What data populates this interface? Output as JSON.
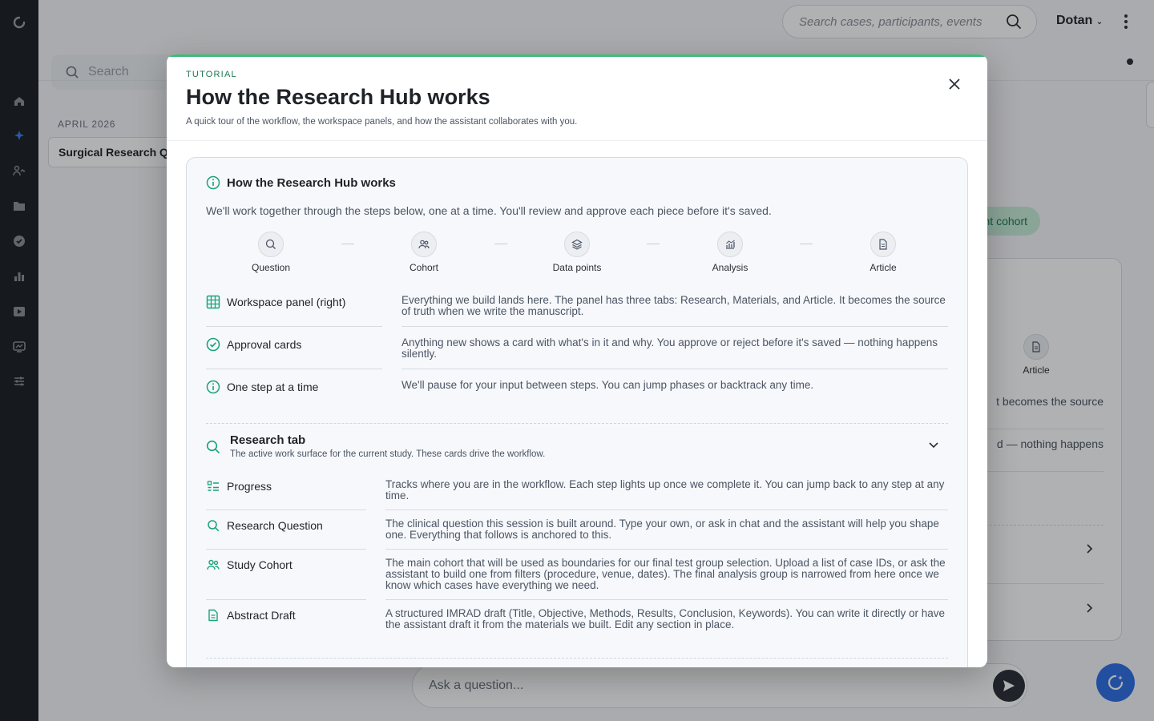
{
  "app": {
    "search_placeholder": "Search cases, participants, events",
    "user_name": "Dotan",
    "sidebar_search_placeholder": "Search",
    "month_label": "APRIL 2026",
    "session_title": "Surgical Research Qu",
    "pill_label": "nt cohort",
    "bg_card": {
      "step_label": "Article",
      "text_1": "t becomes the source",
      "text_2": "d — nothing happens"
    },
    "ask_placeholder": "Ask a question..."
  },
  "modal": {
    "eyebrow": "TUTORIAL",
    "title": "How the Research Hub works",
    "subtitle": "A quick tour of the workflow, the workspace panels, and how the assistant collaborates with you.",
    "overview": {
      "heading": "How the Research Hub works",
      "intro": "We'll work together through the steps below, one at a time. You'll review and approve each piece before it's saved.",
      "steps": [
        {
          "label": "Question",
          "icon": "search-icon"
        },
        {
          "label": "Cohort",
          "icon": "users-icon"
        },
        {
          "label": "Data points",
          "icon": "layers-icon"
        },
        {
          "label": "Analysis",
          "icon": "chart-icon"
        },
        {
          "label": "Article",
          "icon": "document-icon"
        }
      ],
      "features": [
        {
          "label": "Workspace panel (right)",
          "icon": "grid-icon",
          "desc": "Everything we build lands here. The panel has three tabs: Research, Materials, and Article. It becomes the source of truth when we write the manuscript."
        },
        {
          "label": "Approval cards",
          "icon": "check-circle-icon",
          "desc": "Anything new shows a card with what's in it and why. You approve or reject before it's saved — nothing happens silently."
        },
        {
          "label": "One step at a time",
          "icon": "info-icon",
          "desc": "We'll pause for your input between steps. You can jump phases or backtrack any time."
        }
      ]
    },
    "research_tab": {
      "title": "Research tab",
      "subtitle": "The active work surface for the current study. These cards drive the workflow.",
      "cards": [
        {
          "label": "Progress",
          "icon": "list-icon",
          "desc": "Tracks where you are in the workflow. Each step lights up once we complete it. You can jump back to any step at any time."
        },
        {
          "label": "Research Question",
          "icon": "search-icon",
          "desc": "The clinical question this session is built around. Type your own, or ask in chat and the assistant will help you shape one. Everything that follows is anchored to this."
        },
        {
          "label": "Study Cohort",
          "icon": "users-icon",
          "desc": "The main cohort that will be used as boundaries for our final test group selection. Upload a list of case IDs, or ask the assistant to build one from filters (procedure, venue, dates). The final analysis group is narrowed from here once we know which cases have everything we need."
        },
        {
          "label": "Abstract Draft",
          "icon": "document-icon",
          "desc": "A structured IMRAD draft (Title, Objective, Methods, Results, Conclusion, Keywords). You can write it directly or have the assistant draft it from the materials we built. Edit any section in place."
        }
      ]
    }
  },
  "colors": {
    "accent_green": "#3fba7a",
    "icon_teal": "#1aa37a",
    "fab_blue": "#2f6fe4"
  }
}
